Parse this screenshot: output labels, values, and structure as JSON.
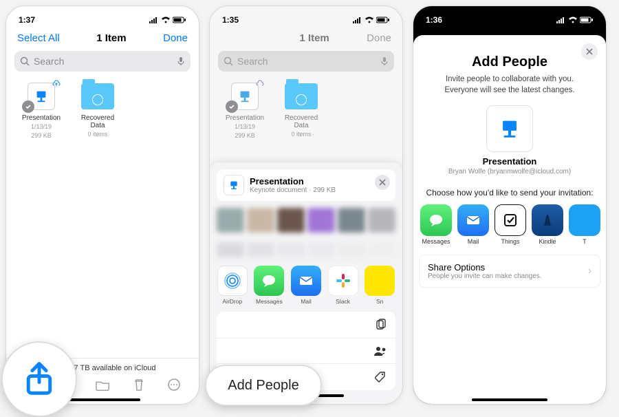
{
  "status": {
    "time1": "1:37",
    "time2": "1:35",
    "time3": "1:36"
  },
  "p1": {
    "select_all": "Select All",
    "title": "1 Item",
    "done": "Done",
    "search_ph": "Search",
    "file_name": "Presentation",
    "file_date": "1/13/19",
    "file_size": "299 KB",
    "folder_name": "Recovered Data",
    "folder_meta": "0 items",
    "footer": "ms, 1.77 TB available on iCloud"
  },
  "p2": {
    "title": "1 Item",
    "done": "Done",
    "search_ph": "Search",
    "file_name": "Presentation",
    "file_date": "1/13/19",
    "file_size": "299 KB",
    "folder_name": "Recovered Data",
    "folder_meta": "0 items",
    "sheet_title": "Presentation",
    "sheet_sub": "Keynote document · 299 KB",
    "apps": {
      "airdrop": "AirDrop",
      "messages": "Messages",
      "mail": "Mail",
      "slack": "Slack",
      "sn": "Sn"
    },
    "actions": {
      "copy": "Copy",
      "add_people": "Add People",
      "tags": "Tags"
    }
  },
  "p3": {
    "heading": "Add People",
    "sub": "Invite people to collaborate with you. Everyone will see the latest changes.",
    "doc": "Presentation",
    "owner": "Bryan Wolfe (bryanmwolfe@icloud.com)",
    "choose": "Choose how you'd like to send your invitation:",
    "apps": {
      "messages": "Messages",
      "mail": "Mail",
      "things": "Things",
      "kindle": "Kindle",
      "tw": "T"
    },
    "share_options": "Share Options",
    "share_sub": "People you invite can make changes."
  },
  "callout_add_people": "Add People"
}
